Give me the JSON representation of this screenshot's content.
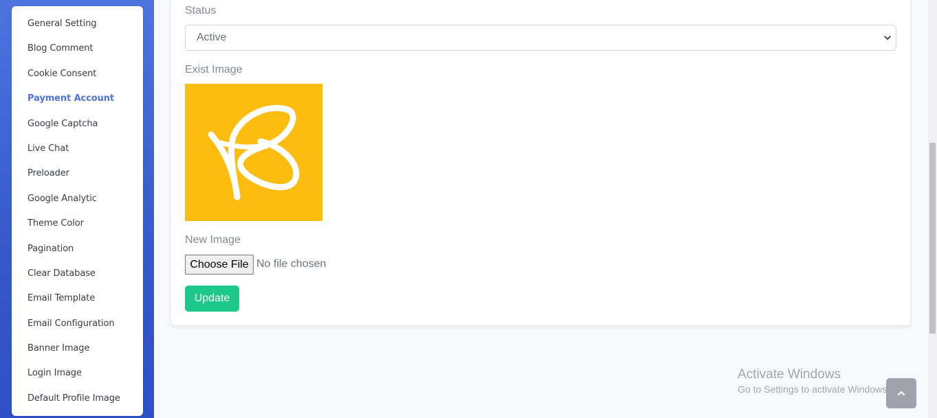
{
  "sidebar": {
    "items": [
      {
        "label": "General Setting",
        "active": false
      },
      {
        "label": "Blog Comment",
        "active": false
      },
      {
        "label": "Cookie Consent",
        "active": false
      },
      {
        "label": "Payment Account",
        "active": true
      },
      {
        "label": "Google Captcha",
        "active": false
      },
      {
        "label": "Live Chat",
        "active": false
      },
      {
        "label": "Preloader",
        "active": false
      },
      {
        "label": "Google Analytic",
        "active": false
      },
      {
        "label": "Theme Color",
        "active": false
      },
      {
        "label": "Pagination",
        "active": false
      },
      {
        "label": "Clear Database",
        "active": false
      },
      {
        "label": "Email Template",
        "active": false
      },
      {
        "label": "Email Configuration",
        "active": false
      },
      {
        "label": "Banner Image",
        "active": false
      },
      {
        "label": "Login Image",
        "active": false
      },
      {
        "label": "Default Profile Image",
        "active": false
      }
    ]
  },
  "form": {
    "status_label": "Status",
    "status_value": "Active",
    "exist_image_label": "Exist Image",
    "new_image_label": "New Image",
    "choose_file_label": "Choose File",
    "file_status": "No file chosen",
    "update_label": "Update"
  },
  "watermark": {
    "title": "Activate Windows",
    "subtitle": "Go to Settings to activate Windows."
  },
  "colors": {
    "sidebar_gradient_top": "#4e73df",
    "active_menu": "#4e73df",
    "update_button": "#1cc88a",
    "image_background": "#fdbd10"
  },
  "icons": {
    "select_arrow": "chevron-down-icon",
    "scroll_top": "chevron-up-icon",
    "logo": "butterfly-logo"
  }
}
